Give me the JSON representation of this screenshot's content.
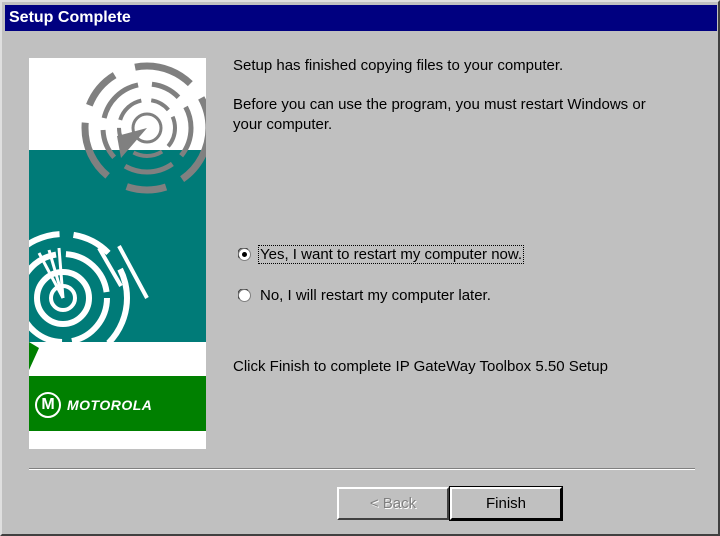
{
  "window": {
    "title": "Setup Complete"
  },
  "graphic": {
    "brand": "MOTOROLA"
  },
  "messages": {
    "finished": "Setup has finished copying files to your computer.",
    "restart_line1": "Before you can use the program, you must restart Windows or",
    "restart_line2": "your computer.",
    "finish_prompt": "Click Finish to complete IP GateWay Toolbox 5.50 Setup"
  },
  "options": {
    "restart_now": {
      "label": "Yes, I want to restart my computer now.",
      "selected": true
    },
    "restart_later": {
      "label": "No, I will restart my computer later.",
      "selected": false
    }
  },
  "buttons": {
    "back": {
      "label": "< Back",
      "enabled": false
    },
    "finish": {
      "label": "Finish",
      "enabled": true
    }
  },
  "colors": {
    "title_bar": "#000080",
    "teal": "#007b78",
    "brand_green": "#008000"
  }
}
